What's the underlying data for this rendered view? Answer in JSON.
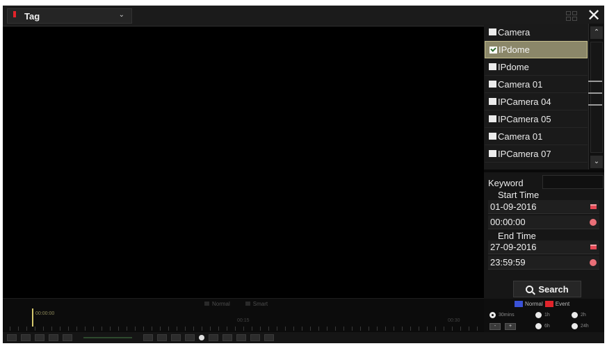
{
  "topbar": {
    "tag_label": "Tag",
    "tag_marker_color": "#e3232a",
    "grid_icon": "grid-view-icon",
    "close_icon": "close-icon",
    "close_glyph": "✕"
  },
  "camera_list": {
    "items": [
      {
        "label": "Camera",
        "checked": false
      },
      {
        "label": "IPdome",
        "checked": true
      },
      {
        "label": "IPdome",
        "checked": false
      },
      {
        "label": "Camera 01",
        "checked": false
      },
      {
        "label": "IPCamera 04",
        "checked": false
      },
      {
        "label": "IPCamera 05",
        "checked": false
      },
      {
        "label": "Camera 01",
        "checked": false
      },
      {
        "label": "IPCamera 07",
        "checked": false
      }
    ],
    "up_glyph": "⌃",
    "down_glyph": "⌄"
  },
  "search": {
    "keyword_label": "Keyword",
    "keyword_value": "",
    "start_time_label": "Start Time",
    "start_date": "01-09-2016",
    "start_time": "00:00:00",
    "end_time_label": "End Time",
    "end_date": "27-09-2016",
    "end_time": "23:59:59",
    "button_label": "Search"
  },
  "timeline": {
    "legend_normal": "Normal",
    "legend_smart": "Smart",
    "cursor_time": "00:00:00",
    "mid_label": "00:15",
    "end_label": "00:30"
  },
  "playback_legend": {
    "normal_label": "Normal",
    "event_label": "Event",
    "normal_color": "#3a52d6",
    "event_color": "#e0242b",
    "spans": [
      "30mins",
      "1h",
      "2h",
      "6h",
      "24h"
    ],
    "selected_span": "30mins",
    "zoom_out": "-",
    "zoom_in": "+"
  }
}
